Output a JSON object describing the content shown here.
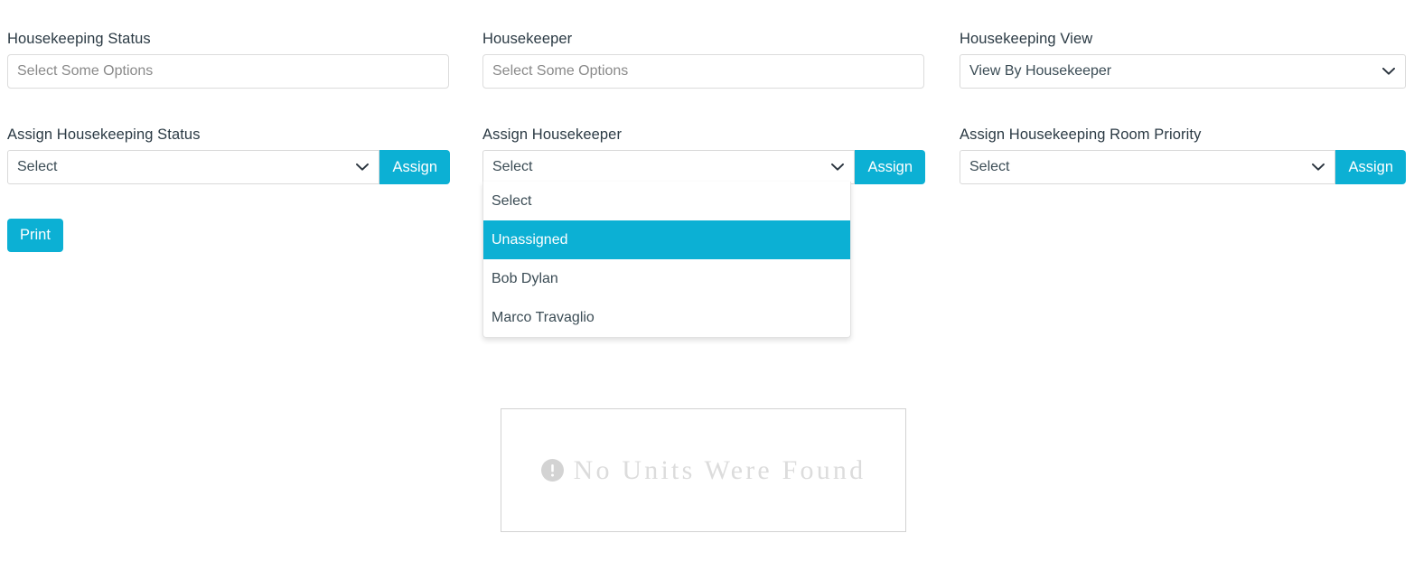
{
  "filters": {
    "housekeeping_status": {
      "label": "Housekeeping Status",
      "placeholder": "Select Some Options",
      "value": ""
    },
    "housekeeper": {
      "label": "Housekeeper",
      "placeholder": "Select Some Options",
      "value": ""
    },
    "housekeeping_view": {
      "label": "Housekeeping View",
      "value": "View By Housekeeper",
      "options": [
        "View By Housekeeper"
      ]
    }
  },
  "assign": {
    "housekeeping_status": {
      "label": "Assign Housekeeping Status",
      "value": "Select",
      "button_label": "Assign"
    },
    "housekeeper": {
      "label": "Assign Housekeeper",
      "value": "Select",
      "button_label": "Assign",
      "dropdown_open": true,
      "options": [
        {
          "label": "Select",
          "selected": false
        },
        {
          "label": "Unassigned",
          "selected": true
        },
        {
          "label": "Bob Dylan",
          "selected": false
        },
        {
          "label": "Marco Travaglio",
          "selected": false
        }
      ]
    },
    "room_priority": {
      "label": "Assign Housekeeping Room Priority",
      "value": "Select",
      "button_label": "Assign"
    }
  },
  "actions": {
    "print_label": "Print"
  },
  "results": {
    "empty_message": "No Units Were Found",
    "icon": "exclamation-circle-icon"
  },
  "colors": {
    "accent": "#0cb0d4",
    "label_text": "#2b3a44",
    "placeholder_text": "#8a8a8a",
    "empty_text": "#dcdcdc"
  }
}
